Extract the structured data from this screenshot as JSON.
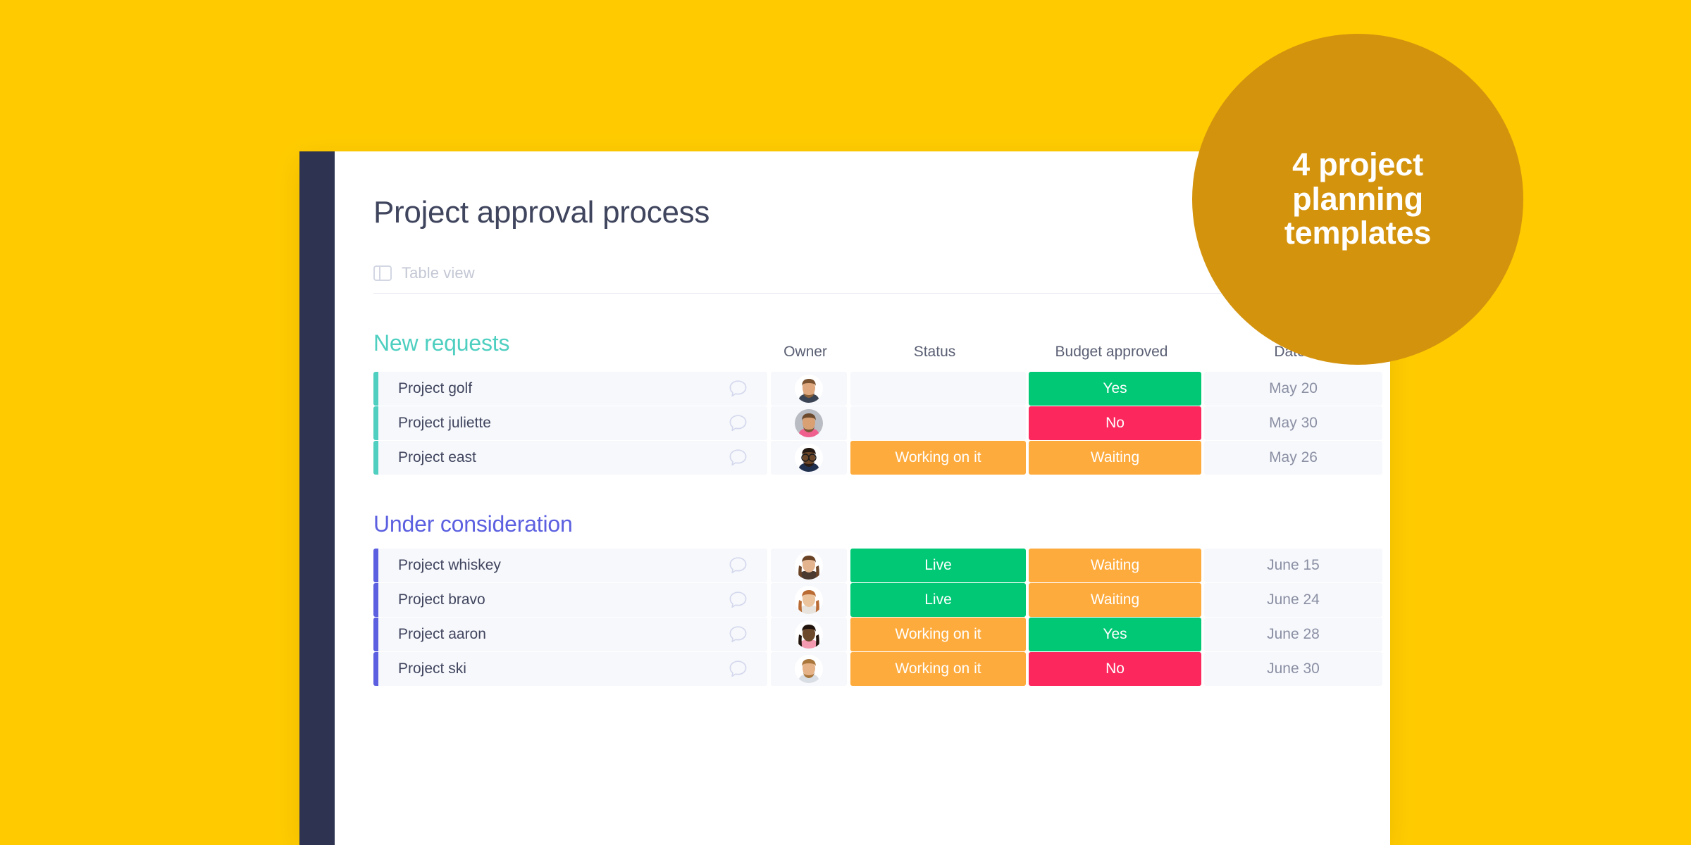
{
  "theme": {
    "background": "#FFCB00",
    "nav_rail": "#2D3350",
    "card": "#FFFFFF",
    "cell": "#F7F8FC",
    "green": "#00C875",
    "red": "#FB275D",
    "orange": "#FDAB3D",
    "teal": "#4ECFC0",
    "indigo": "#5B5FE0",
    "badge": "#D4930D"
  },
  "header": {
    "title": "Project approval process",
    "view_label": "Table view",
    "view_icon": "table-view-icon"
  },
  "columns": {
    "owner": "Owner",
    "status": "Status",
    "budget": "Budget approved",
    "date": "Date"
  },
  "promo": {
    "text": "4 project\nplanning\ntemplates"
  },
  "groups": [
    {
      "title": "New requests",
      "color": "#4ECFC0",
      "rows": [
        {
          "name": "Project golf",
          "comment_icon": "comment-bubble-icon",
          "avatar": "avatar-male-beard-teal",
          "status": {
            "label": "",
            "color": ""
          },
          "budget": {
            "label": "Yes",
            "color": "#00C875"
          },
          "date": "May 20"
        },
        {
          "name": "Project juliette",
          "comment_icon": "comment-bubble-icon",
          "avatar": "avatar-male-floral-shirt",
          "status": {
            "label": "",
            "color": ""
          },
          "budget": {
            "label": "No",
            "color": "#FB275D"
          },
          "date": "May 30"
        },
        {
          "name": "Project east",
          "comment_icon": "comment-bubble-icon",
          "avatar": "avatar-male-glasses",
          "status": {
            "label": "Working on it",
            "color": "#FDAB3D"
          },
          "budget": {
            "label": "Waiting",
            "color": "#FDAB3D"
          },
          "date": "May 26"
        }
      ]
    },
    {
      "title": "Under consideration",
      "color": "#5B5FE0",
      "rows": [
        {
          "name": "Project whiskey",
          "comment_icon": "comment-bubble-icon",
          "avatar": "avatar-female-brunette",
          "status": {
            "label": "Live",
            "color": "#00C875"
          },
          "budget": {
            "label": "Waiting",
            "color": "#FDAB3D"
          },
          "date": "June 15"
        },
        {
          "name": "Project bravo",
          "comment_icon": "comment-bubble-icon",
          "avatar": "avatar-female-ginger",
          "status": {
            "label": "Live",
            "color": "#00C875"
          },
          "budget": {
            "label": "Waiting",
            "color": "#FDAB3D"
          },
          "date": "June 24"
        },
        {
          "name": "Project aaron",
          "comment_icon": "comment-bubble-icon",
          "avatar": "avatar-female-pink-top",
          "status": {
            "label": "Working on it",
            "color": "#FDAB3D"
          },
          "budget": {
            "label": "Yes",
            "color": "#00C875"
          },
          "date": "June 28"
        },
        {
          "name": "Project ski",
          "comment_icon": "comment-bubble-icon",
          "avatar": "avatar-male-blond",
          "status": {
            "label": "Working on it",
            "color": "#FDAB3D"
          },
          "budget": {
            "label": "No",
            "color": "#FB275D"
          },
          "date": "June 30"
        }
      ]
    }
  ]
}
